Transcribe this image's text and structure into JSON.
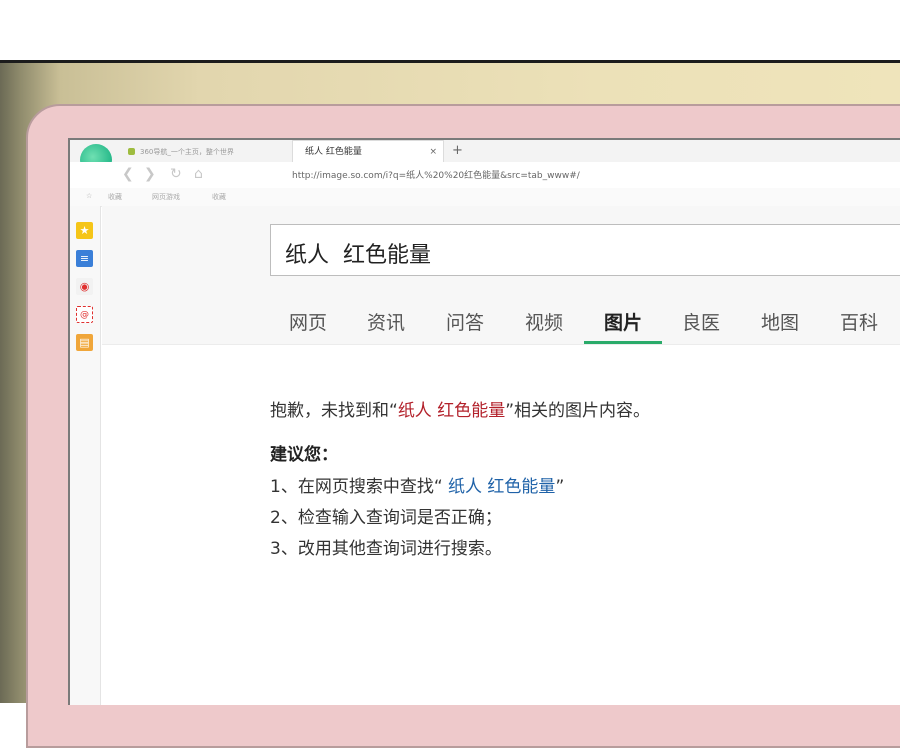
{
  "browser": {
    "tab_inactive_label": "360导航_一个主页，整个世界",
    "tab_active_label": "纸人 红色能量",
    "close_glyph": "×",
    "new_tab_glyph": "+",
    "url": "http://image.so.com/i?q=纸人%20%20红色能量&src=tab_www#/",
    "bookmarks": [
      "收藏",
      "网页游戏",
      "收藏"
    ]
  },
  "search": {
    "query": "纸人  红色能量"
  },
  "nav_tabs": [
    "网页",
    "资讯",
    "问答",
    "视频",
    "图片",
    "良医",
    "地图",
    "百科"
  ],
  "active_tab": "图片",
  "result": {
    "msg_prefix": "抱歉，未找到和“",
    "msg_keyword": "纸人 红色能量",
    "msg_suffix": "”相关的图片内容。",
    "suggest_title": "建议您：",
    "s1_prefix": "1、在网页搜索中查找“ ",
    "s1_link": "纸人 红色能量",
    "s1_suffix": "”",
    "s2": "2、检查输入查询词是否正确；",
    "s3": "3、改用其他查询词进行搜索。"
  },
  "colors": {
    "accent": "#2aab6a",
    "keyword_red": "#b3212b",
    "link_blue": "#1f62a8"
  }
}
